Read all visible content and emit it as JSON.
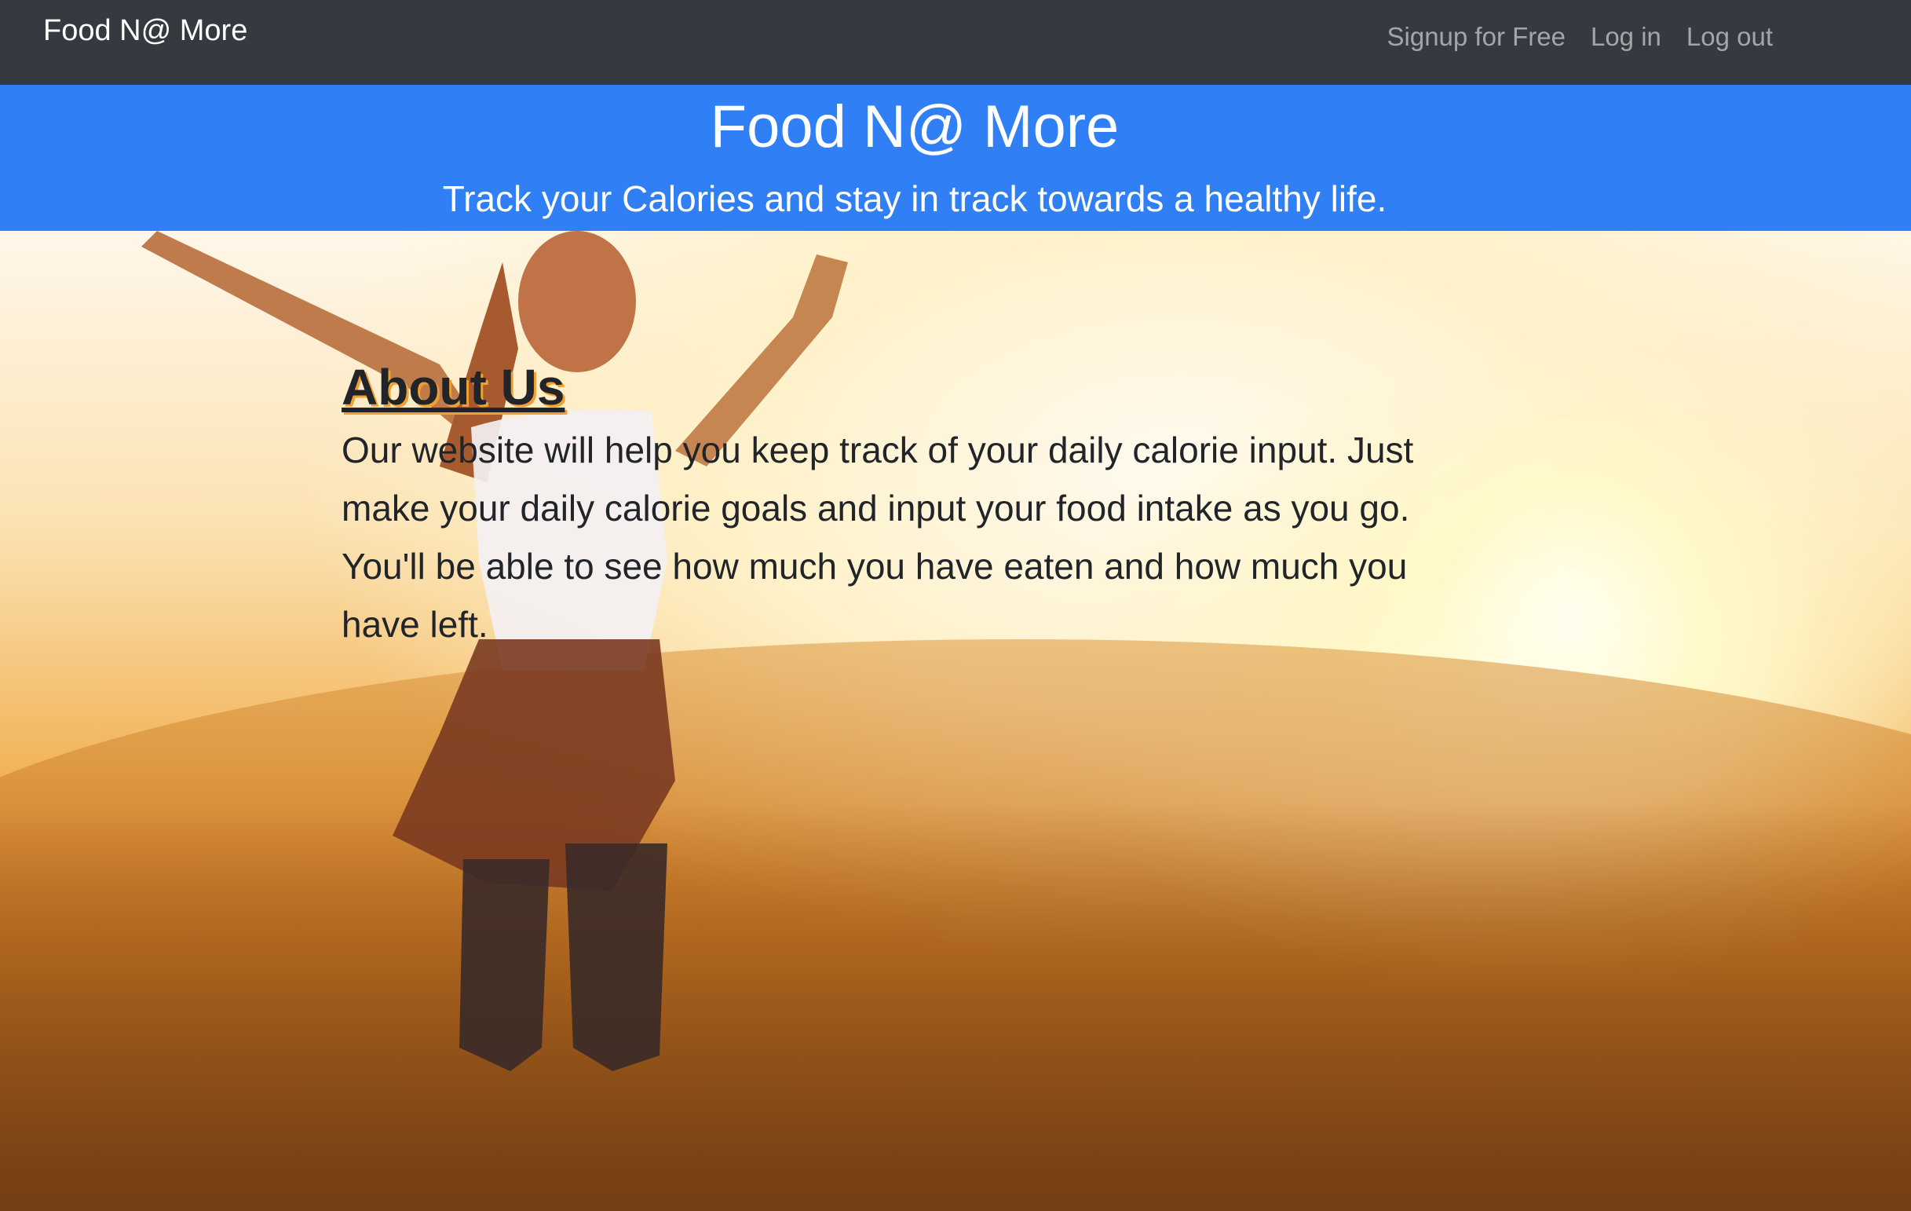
{
  "navbar": {
    "brand": "Food N@ More",
    "links": [
      {
        "label": "Signup for Free"
      },
      {
        "label": "Log in"
      },
      {
        "label": "Log out"
      }
    ]
  },
  "banner": {
    "title": "Food N@ More",
    "subtitle": "Track your Calories and stay in track towards a healthy life."
  },
  "about": {
    "title": "About Us",
    "text": "Our website will help you keep track of your daily calorie input. Just make your daily calorie goals and input your food intake as you go. You'll be able to see how much you have eaten and how much you have left."
  },
  "colors": {
    "navbar_bg": "#343a40",
    "banner_bg": "#317ff5",
    "title_shadow": "#f0a030"
  }
}
